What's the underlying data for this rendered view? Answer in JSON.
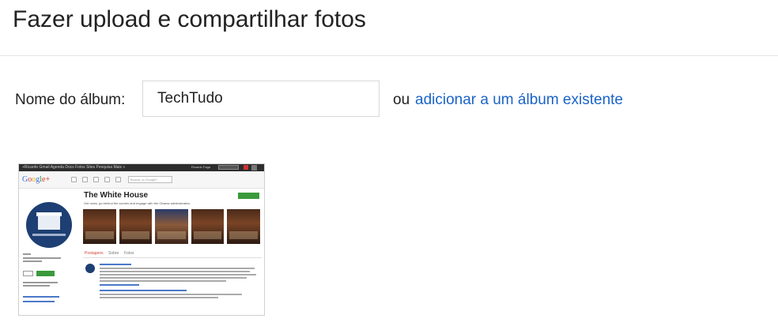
{
  "page": {
    "title": "Fazer upload e compartilhar fotos"
  },
  "form": {
    "album_label": "Nome do álbum:",
    "album_value": "TechTudo",
    "or_text": "ou",
    "add_existing_link": "adicionar a um álbum existente"
  },
  "thumbnail": {
    "topbar_text": "+Ricardo  Gmail  Agenda  Docs  Fotos  Sites  Pesquisa  Mais »",
    "topbar_user": "Ricardo Faga",
    "logo": {
      "g": "G",
      "o1": "o",
      "o2": "o",
      "g2": "g",
      "l": "l",
      "e": "e",
      "plus": "+"
    },
    "search_placeholder": "Buscar no Google+",
    "page_name": "The White House",
    "page_subtitle": "Get news, go behind the scenes and engage with the Obama administration",
    "tabs": [
      "Postagens",
      "Sobre",
      "Fotos"
    ]
  },
  "colors": {
    "link": "#1a63c7",
    "divider": "#e5e5e5"
  }
}
